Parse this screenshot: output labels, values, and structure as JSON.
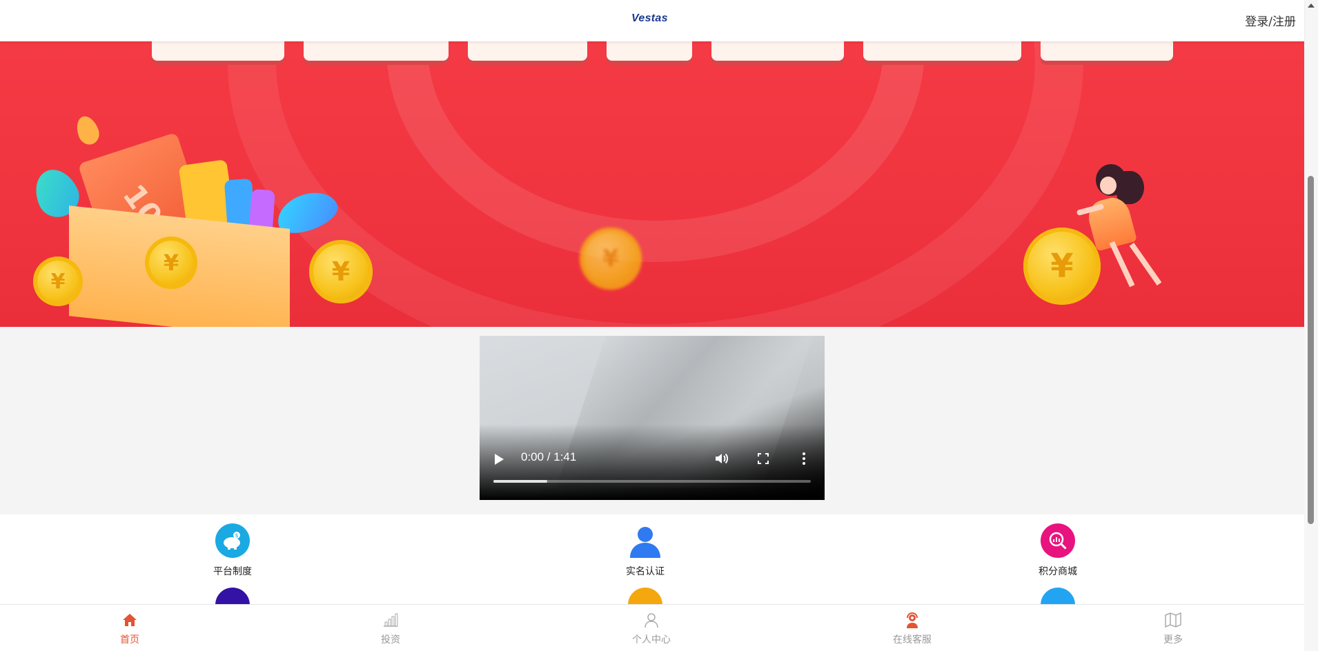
{
  "header": {
    "logo_text": "Vestas",
    "login_label": "登录/注册"
  },
  "banner": {
    "card_text": "100",
    "coin_symbol": "¥"
  },
  "video": {
    "time_display": "0:00 / 1:41",
    "progress_fraction": 0.17
  },
  "grid": {
    "items": [
      {
        "label": "平台制度",
        "icon": "piggy-bank-icon",
        "color": "#1aa9e3"
      },
      {
        "label": "实名认证",
        "icon": "user-icon",
        "color": "#2f7af0"
      },
      {
        "label": "积分商城",
        "icon": "chart-search-icon",
        "color": "#e8137e"
      }
    ],
    "partial_icons": [
      {
        "icon": "pen-icon",
        "color": "#3312a6"
      },
      {
        "icon": "refresh-icon",
        "color": "#f4a70f"
      },
      {
        "icon": "yen-icon",
        "color": "#23a4f2"
      }
    ]
  },
  "nav": {
    "items": [
      {
        "label": "首页",
        "icon": "home-icon",
        "active": true
      },
      {
        "label": "投资",
        "icon": "bar-chart-icon",
        "active": false
      },
      {
        "label": "个人中心",
        "icon": "person-icon",
        "active": false
      },
      {
        "label": "在线客服",
        "icon": "support-agent-icon",
        "active": false
      },
      {
        "label": "更多",
        "icon": "map-icon",
        "active": false
      }
    ]
  },
  "colors": {
    "accent": "#e35432",
    "banner_red": "#f0343f"
  }
}
